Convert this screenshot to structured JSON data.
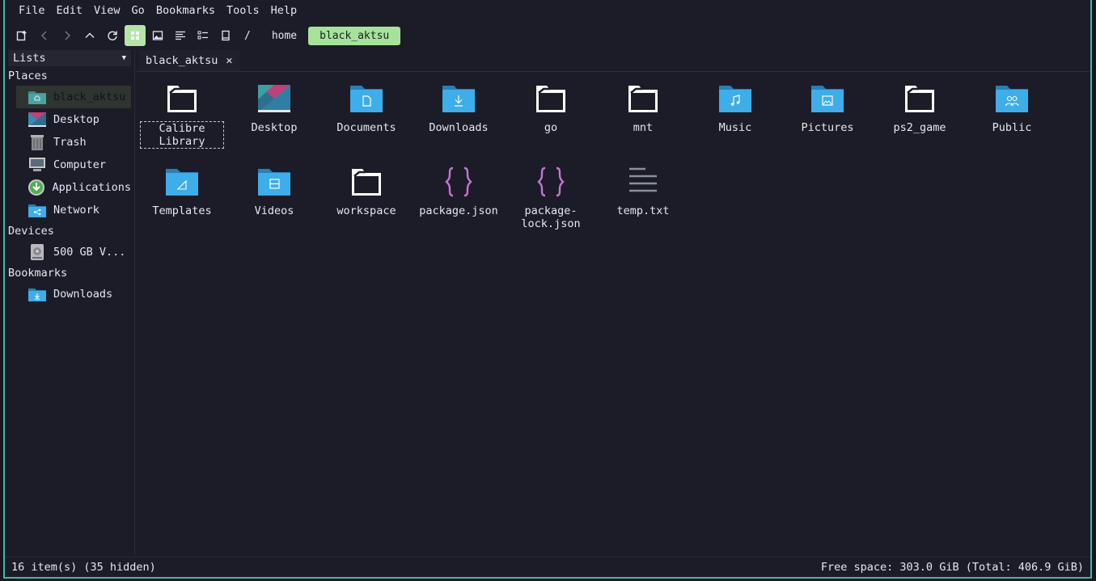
{
  "menubar": {
    "items": [
      "File",
      "Edit",
      "View",
      "Go",
      "Bookmarks",
      "Tools",
      "Help"
    ]
  },
  "toolbar": {
    "buttons": [
      {
        "icon": "new-tab-icon"
      },
      {
        "icon": "back-icon"
      },
      {
        "icon": "forward-icon"
      },
      {
        "icon": "up-icon"
      },
      {
        "icon": "reload-icon"
      },
      {
        "icon": "icon-view-icon"
      },
      {
        "icon": "thumbnail-view-icon"
      },
      {
        "icon": "compact-view-icon"
      },
      {
        "icon": "detailed-list-view-icon"
      },
      {
        "icon": "device-icon"
      }
    ],
    "breadcrumb": {
      "root": "/",
      "items": [
        "home",
        "black_aktsu"
      ]
    }
  },
  "sidebar": {
    "lists_label": "Lists",
    "sections": [
      {
        "title": "Places",
        "items": [
          "black_aktsu",
          "Desktop",
          "Trash",
          "Computer",
          "Applications",
          "Network"
        ]
      },
      {
        "title": "Devices",
        "items": [
          "500 GB V..."
        ]
      },
      {
        "title": "Bookmarks",
        "items": [
          "Downloads"
        ]
      }
    ]
  },
  "tab": {
    "label": "black_aktsu",
    "close": "✕"
  },
  "files": [
    "Calibre Library",
    "Desktop",
    "Documents",
    "Downloads",
    "go",
    "mnt",
    "Music",
    "Pictures",
    "ps2_game",
    "Public",
    "Templates",
    "Videos",
    "workspace",
    "package.json",
    "package-lock.json",
    "temp.txt"
  ],
  "status": {
    "left": "16 item(s) (35 hidden)",
    "right": "Free space: 303.0 GiB (Total: 406.9 GiB)"
  },
  "colors": {
    "accent": "#a6e39a",
    "folder": "#3daee9",
    "json": "#c774d6",
    "border": "#3fb8a6"
  }
}
